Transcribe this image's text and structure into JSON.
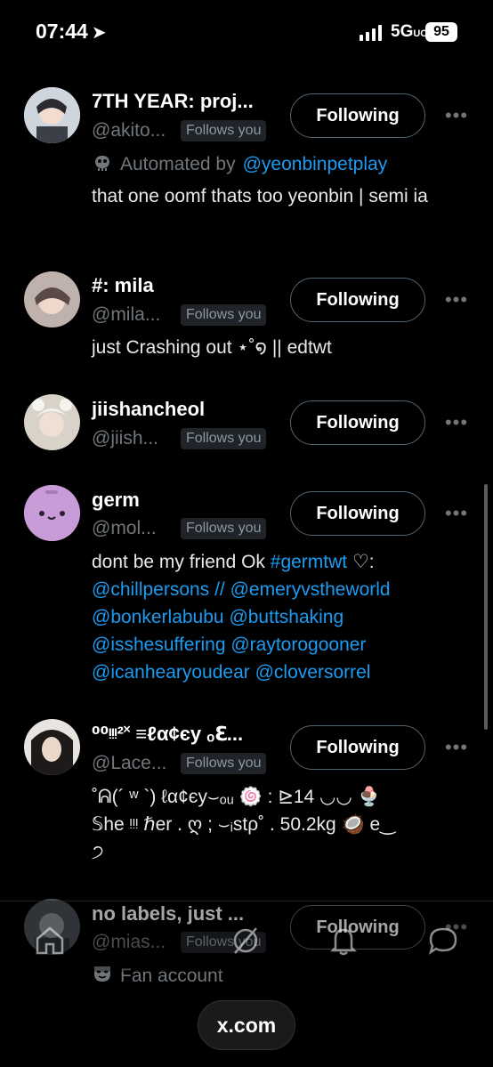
{
  "status_bar": {
    "time": "07:44",
    "network": "5G",
    "network_suffix": "UC",
    "battery": "95"
  },
  "accounts": [
    {
      "name": "7TH YEAR: proj...",
      "handle": "@akito...",
      "follows_you": "Follows you",
      "button": "Following",
      "automated_prefix": "Automated by",
      "automated_by": "@yeonbinpetplay",
      "bio": "that one oomf thats too yeonbin | semi ia",
      "avatar_color": "#d9dde3"
    },
    {
      "name": "#: mila",
      "handle": "@mila...",
      "follows_you": "Follows you",
      "button": "Following",
      "bio": "just Crashing out ⋆˚໑ || edtwt",
      "avatar_color": "#c9b9b4"
    },
    {
      "name": "jiishancheol",
      "handle": "@jiish...",
      "follows_you": "Follows you",
      "button": "Following",
      "avatar_color": "#e6e1d8"
    },
    {
      "name": "germ",
      "handle": "@mol...",
      "follows_you": "Follows you",
      "button": "Following",
      "bio_plain_1": "dont be my friend Ok ",
      "bio_tag": "#germtwt",
      "bio_plain_2": " ♡:",
      "bio_mentions": [
        "@chillpersons",
        "//",
        "@emeryvstheworld",
        "@bonkerlabubu",
        "@buttshaking",
        "@isshesuffering",
        "@raytorogooner",
        "@icanhearyoudear",
        "@cloversorrel"
      ],
      "avatar_color": "#c89bd9"
    },
    {
      "name": "⁰⁰ᵎᵎᵎ²˟  ≡ℓα¢єу ₒℇ...",
      "handle": "@Lace...",
      "follows_you": "Follows you",
      "button": "Following",
      "bio_line_1": "˚ᕱ(´ ʷ `) ℓα¢єу⌣ₒᵤ 🍥 : ⊵14 ◡◡ 🍨",
      "bio_line_2": "𝕊he ᵎᵎᵎ ℏer . ღ ; ⌣ᵢstρ˚ . 50.2kg 🥥 e‿",
      "bio_line_3": "੭",
      "avatar_color": "#3a3634"
    },
    {
      "name": "no labels, just ...",
      "handle": "@mias...",
      "follows_you": "Follows you",
      "button": "Following",
      "label_icon": "fan-mask-icon",
      "label": "Fan account",
      "avatar_color": "#4a4f55"
    }
  ],
  "browser": {
    "url": "x.com"
  },
  "tabs": [
    "home-icon",
    "grok-icon",
    "notifications-icon",
    "messages-icon"
  ]
}
